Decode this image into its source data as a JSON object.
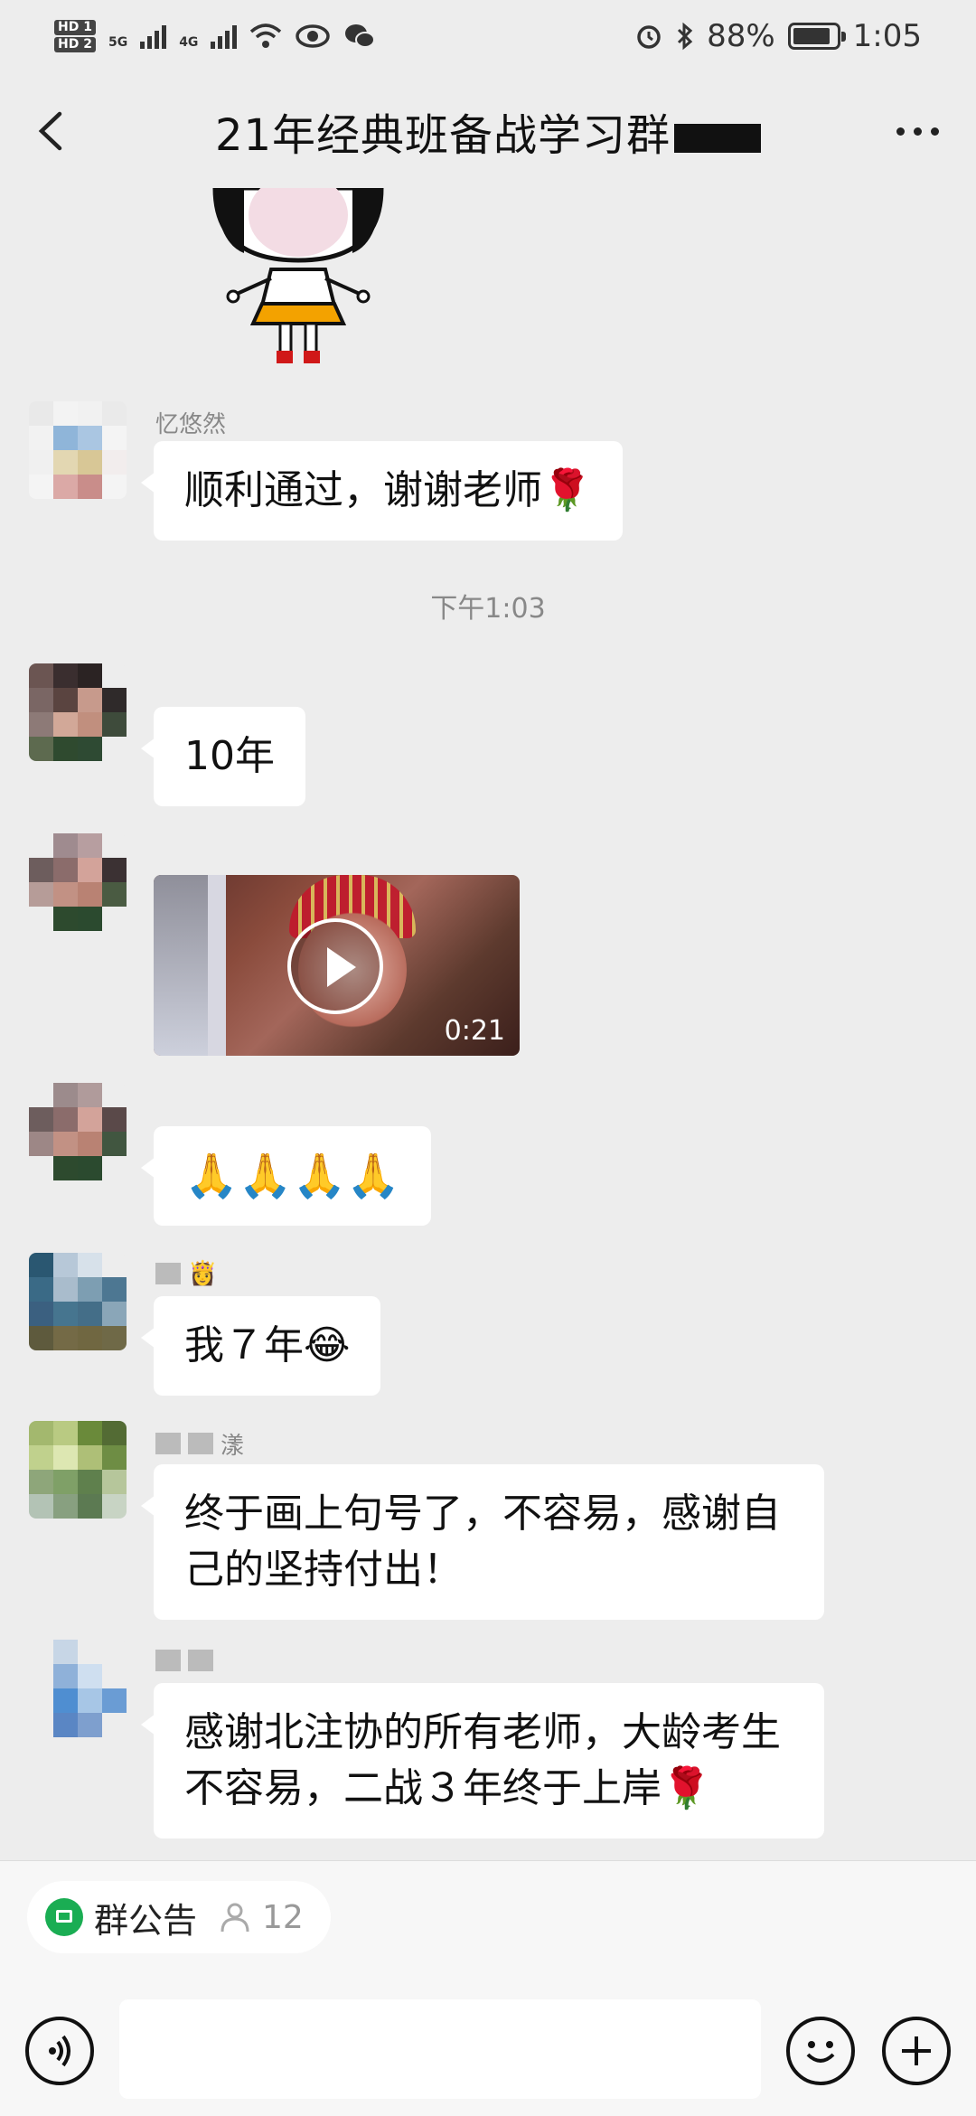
{
  "status_bar": {
    "sim1": "HD 1",
    "sim2": "HD 2",
    "net1": "5G",
    "net2": "4G",
    "battery_percent": "88%",
    "battery_level": 0.88,
    "time": "1:05",
    "icons": [
      "signal-icon",
      "wifi-icon",
      "eye-icon",
      "wechat-icon",
      "alarm-icon",
      "bluetooth-icon",
      "battery-icon"
    ]
  },
  "header": {
    "title": "21年经典班备战学习群"
  },
  "timestamp": "下午1:03",
  "messages": [
    {
      "nickname": "忆悠然",
      "text": "顺利通过，谢谢老师🌹"
    },
    {
      "nickname": "",
      "text": "10年"
    },
    {
      "nickname": "",
      "video_duration": "0:21"
    },
    {
      "nickname": "",
      "text": "🙏🙏🙏🙏"
    },
    {
      "nickname": "👸",
      "text": "我７年😂"
    },
    {
      "nickname": "漾",
      "text": "终于画上句号了，不容易，感谢自己的坚持付出！"
    },
    {
      "nickname": "",
      "text": "感谢北注协的所有老师，大龄考生不容易，二战３年终于上岸🌹"
    }
  ],
  "footer": {
    "notice_label": "群公告",
    "member_count": "12"
  },
  "colors": {
    "background": "#ededed",
    "bubble": "#ffffff",
    "accent_green": "#1aad53"
  }
}
